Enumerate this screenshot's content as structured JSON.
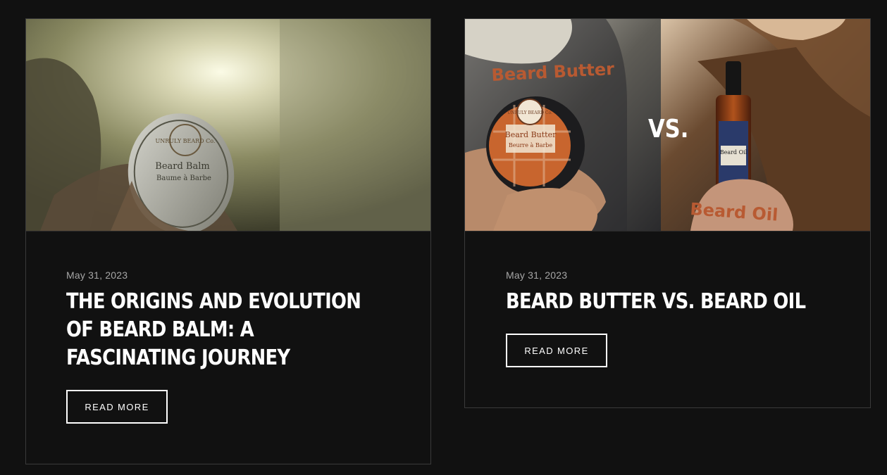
{
  "posts": [
    {
      "date": "May 31, 2023",
      "title": "THE ORIGINS AND EVOLUTION OF BEARD BALM: A FASCINATING JOURNEY",
      "button": "READ MORE",
      "image": {
        "tin_brand": "UNRULY BEARD Co.",
        "tin_label": "Beard Balm",
        "tin_sub": "Baume à Barbe"
      }
    },
    {
      "date": "May 31, 2023",
      "title": "BEARD BUTTER VS. BEARD OIL",
      "button": "READ MORE",
      "image": {
        "left_caption": "Beard Butter",
        "vs_text": "VS.",
        "right_caption": "Beard Oil",
        "tin_brand": "UNRULY BEARD Co.",
        "tin_label": "Beard Butter",
        "tin_sub": "Beurre à Barbe",
        "bottle_label": "Beard Oil"
      }
    }
  ],
  "colors": {
    "background": "#111111",
    "card_border": "#3a3a3a",
    "caption_orange": "#b85a32",
    "text_white": "#ffffff",
    "date_gray": "#a6a6a6"
  }
}
